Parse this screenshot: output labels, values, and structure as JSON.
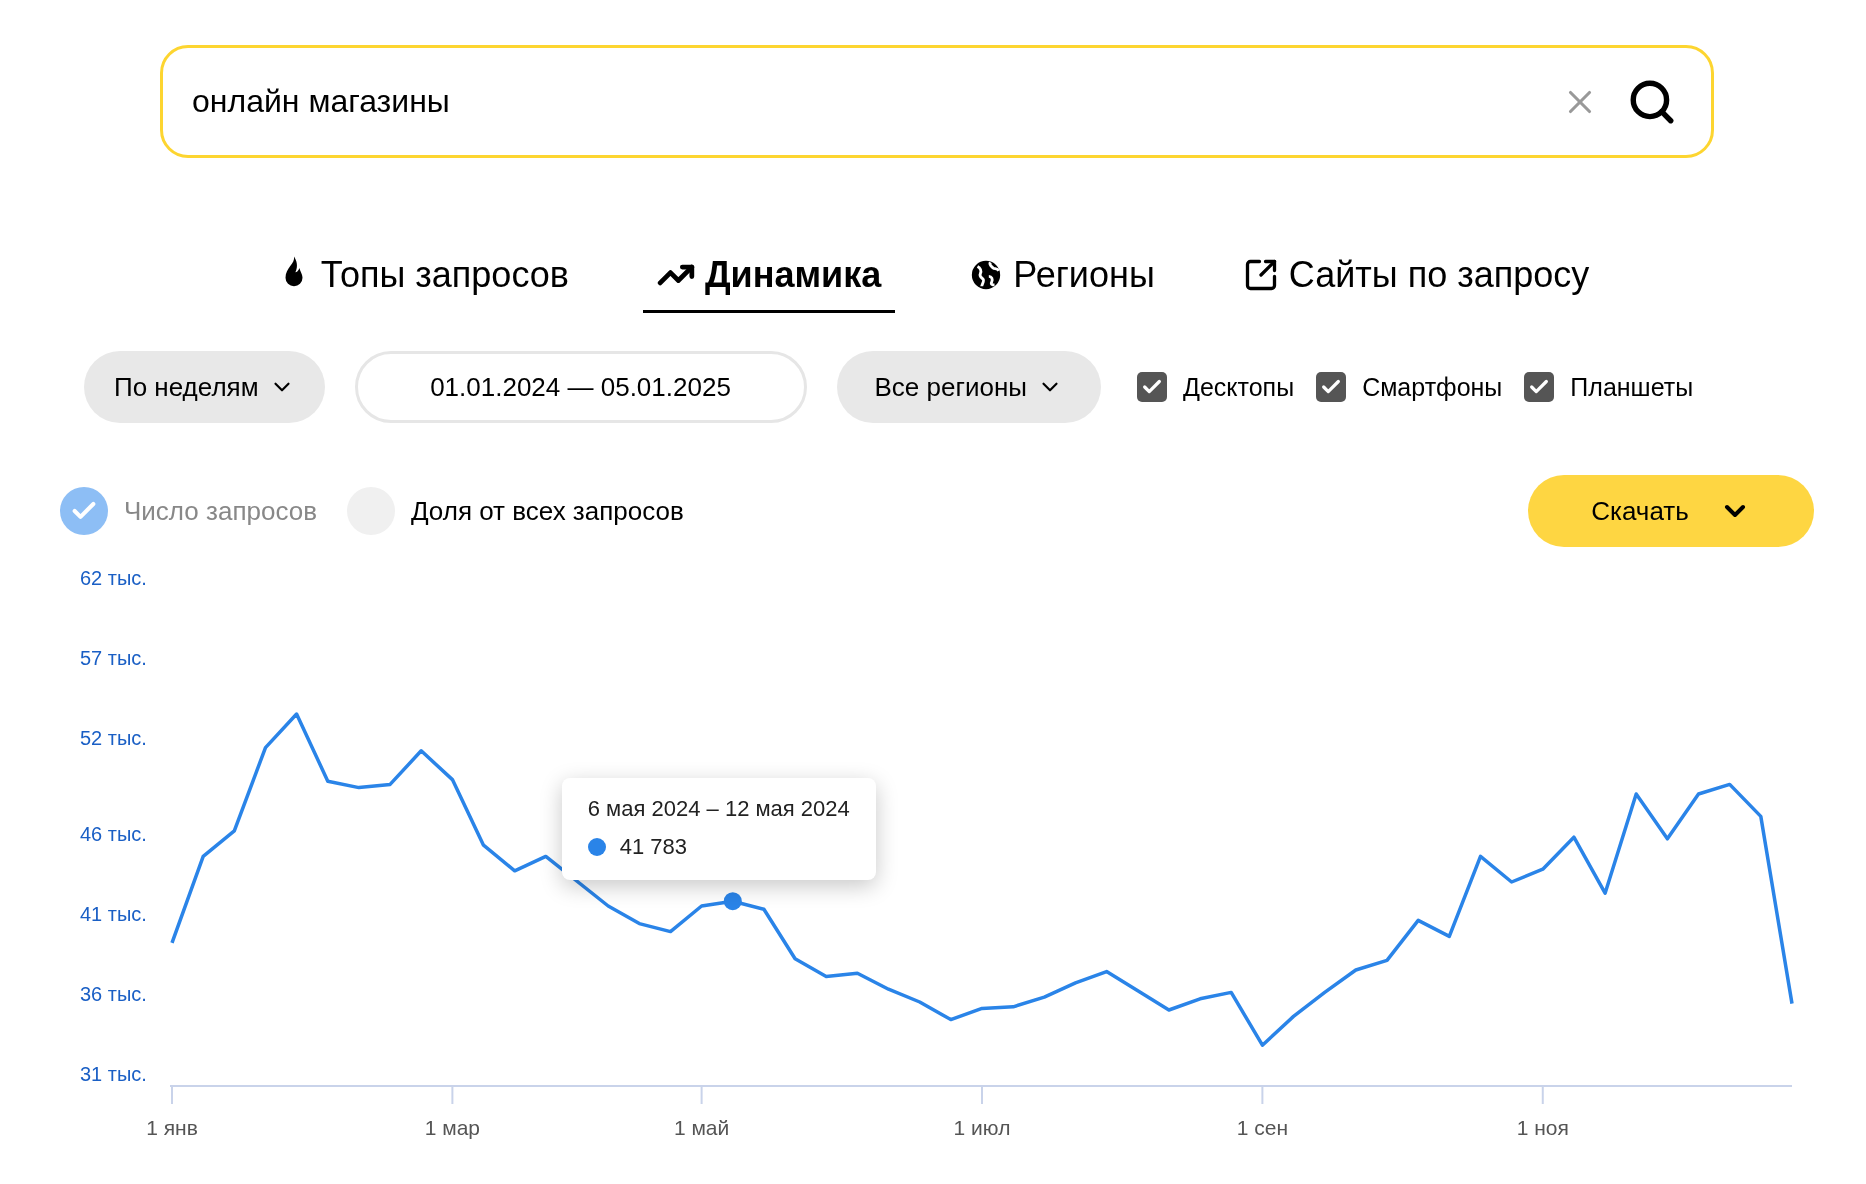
{
  "search": {
    "value": "онлайн магазины"
  },
  "tabs": [
    {
      "label": "Топы запросов",
      "kind": "fire",
      "selected": false
    },
    {
      "label": "Динамика",
      "kind": "trend",
      "selected": true
    },
    {
      "label": "Регионы",
      "kind": "globe",
      "selected": false
    },
    {
      "label": "Сайты по запросу",
      "kind": "external",
      "selected": false
    }
  ],
  "filters": {
    "period": "По неделям",
    "dates": "01.01.2024 — 05.01.2025",
    "region": "Все регионы",
    "devices": [
      {
        "label": "Десктопы",
        "checked": true
      },
      {
        "label": "Смартфоны",
        "checked": true
      },
      {
        "label": "Планшеты",
        "checked": true
      }
    ]
  },
  "modes": [
    {
      "label": "Число запросов",
      "selected": true
    },
    {
      "label": "Доля от всех запросов",
      "selected": false
    }
  ],
  "download_button": "Скачать",
  "chart": {
    "tooltip": {
      "date_range": "6 мая 2024 – 12 мая 2024",
      "value": "41 783"
    },
    "chart_data": {
      "type": "line",
      "categories": [
        "1 янв",
        null,
        null,
        null,
        null,
        null,
        null,
        null,
        null,
        "1 мар",
        null,
        null,
        null,
        null,
        null,
        null,
        null,
        "1 май",
        null,
        null,
        null,
        null,
        null,
        null,
        null,
        null,
        "1 июл",
        null,
        null,
        null,
        null,
        null,
        null,
        null,
        null,
        "1 сен",
        null,
        null,
        null,
        null,
        null,
        null,
        null,
        null,
        "1 ноя",
        null,
        null,
        null,
        null,
        null,
        null,
        null,
        null
      ],
      "series": [
        {
          "color": "#2a84e8",
          "values": [
            39.2,
            44.6,
            46.2,
            51.4,
            53.5,
            49.3,
            48.9,
            49.1,
            51.2,
            49.4,
            45.3,
            43.7,
            44.6,
            null,
            41.5,
            40.4,
            39.9,
            41.5,
            41.8,
            41.3,
            38.2,
            37.1,
            37.3,
            36.3,
            35.5,
            34.4,
            35.1,
            35.2,
            35.8,
            36.7,
            37.4,
            36.2,
            35.0,
            35.7,
            36.1,
            32.8,
            34.6,
            36.1,
            37.5,
            38.1,
            40.6,
            39.6,
            44.6,
            43.0,
            43.8,
            45.8,
            42.3,
            48.5,
            45.7,
            48.5,
            49.1,
            47.1,
            35.4
          ]
        }
      ],
      "ylim": [
        31,
        62
      ],
      "yticks": [
        {
          "value": 31,
          "label": "31 тыс."
        },
        {
          "value": 36,
          "label": "36 тыс."
        },
        {
          "value": 41,
          "label": "41 тыс."
        },
        {
          "value": 46,
          "label": "46 тыс."
        },
        {
          "value": 52,
          "label": "52 тыс."
        },
        {
          "value": 57,
          "label": "57 тыс."
        },
        {
          "value": 62,
          "label": "62 тыс."
        }
      ]
    }
  }
}
